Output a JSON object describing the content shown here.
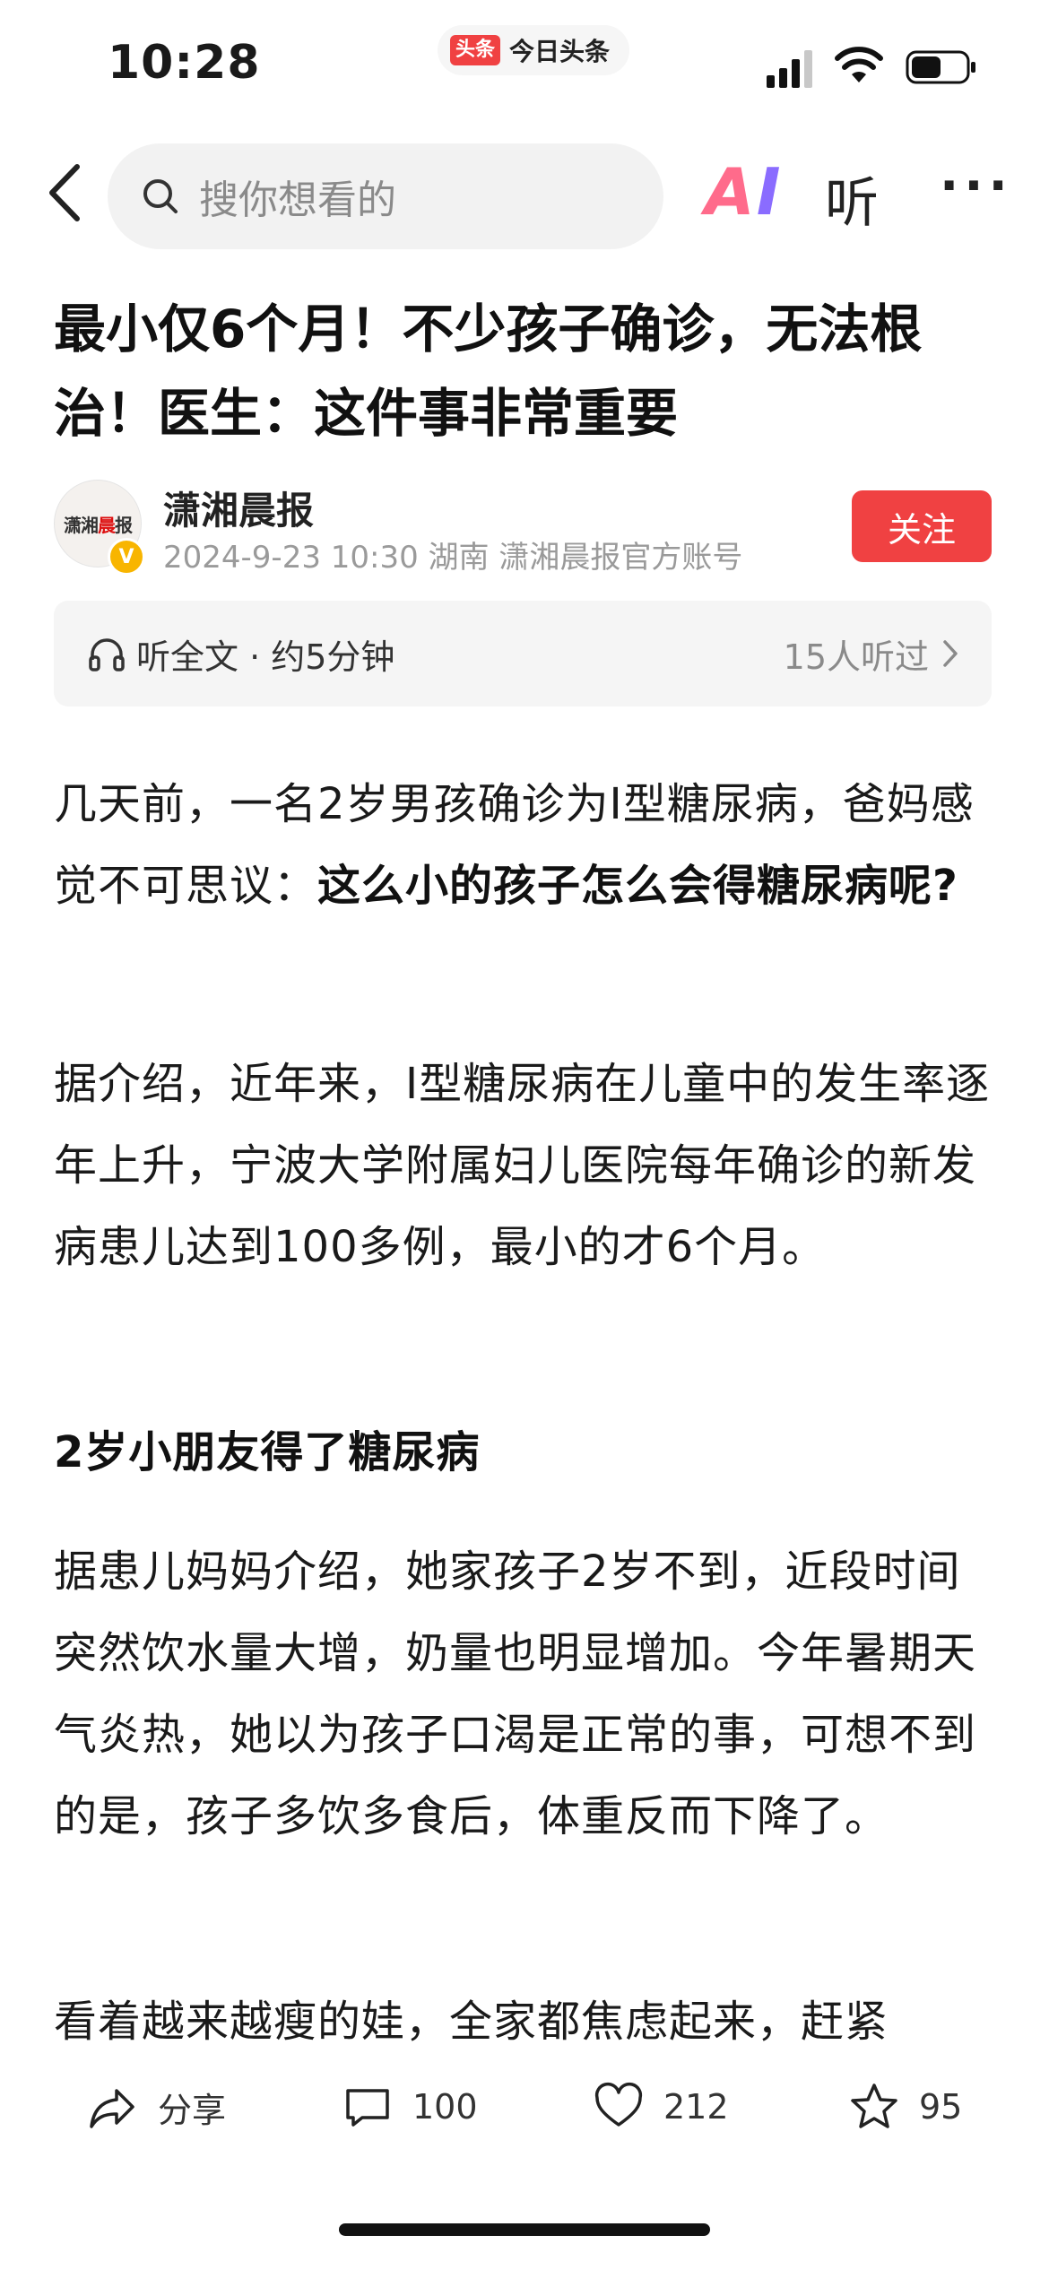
{
  "status_bar": {
    "time": "10:28",
    "app_logo_text": "头条",
    "app_name": "今日头条"
  },
  "nav": {
    "search_placeholder": "搜你想看的",
    "ai_label_a": "A",
    "ai_label_i": "I",
    "listen_label": "听",
    "more_label": "···"
  },
  "article": {
    "title": "最小仅6个月！不少孩子确诊，无法根治！医生：这件事非常重要",
    "author": "潇湘晨报",
    "avatar_text_a": "潇湘",
    "avatar_text_b": "晨",
    "avatar_text_c": "报",
    "verified_mark": "V",
    "meta": "2024-9-23  10:30  湖南  潇湘晨报官方账号",
    "follow_label": "关注",
    "listen_bar_label": "听全文 · 约5分钟",
    "listen_count": "15人听过",
    "p1_plain": "几天前，一名2岁男孩确诊为I型糖尿病，爸妈感觉不可思议：",
    "p1_bold": "这么小的孩子怎么会得糖尿病呢?",
    "p2": "据介绍，近年来，I型糖尿病在儿童中的发生率逐年上升，宁波大学附属妇儿医院每年确诊的新发病患儿达到100多例，最小的才6个月。",
    "subhead": "2岁小朋友得了糖尿病",
    "p3": "据患儿妈妈介绍，她家孩子2岁不到，近段时间突然饮水量大增，奶量也明显增加。今年暑期天气炎热，她以为孩子口渴是正常的事，可想不到的是，孩子多饮多食后，体重反而下降了。",
    "p4": "看着越来越瘦的娃，全家都焦虑起来，赶紧"
  },
  "actions": {
    "share_label": "分享",
    "comment_count": "100",
    "like_count": "212",
    "favorite_count": "95"
  },
  "icons": [
    "back-icon",
    "search-icon",
    "headphones-icon",
    "chevron-right-icon",
    "share-icon",
    "comment-icon",
    "heart-icon",
    "star-icon",
    "signal-icon",
    "wifi-icon",
    "battery-icon"
  ],
  "colors": {
    "accent_red": "#f04142",
    "muted_text": "#9a9a9a"
  }
}
